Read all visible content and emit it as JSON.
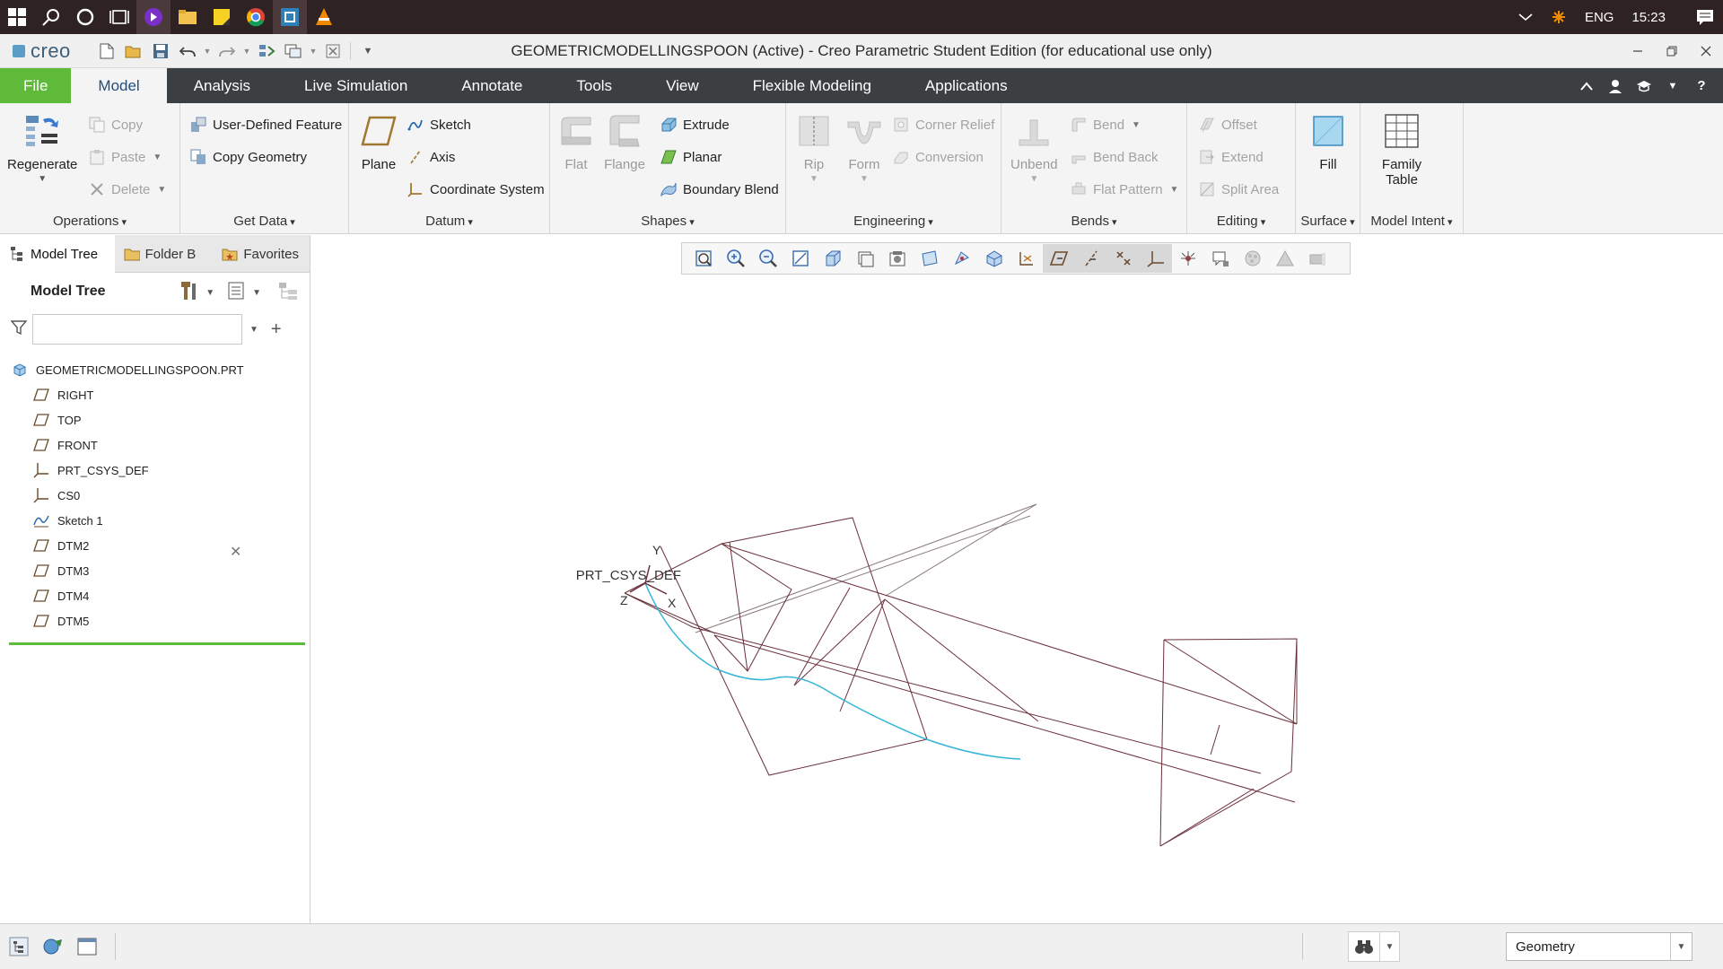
{
  "taskbar": {
    "tray": {
      "lang": "ENG",
      "time": "15:23"
    }
  },
  "window": {
    "app_logo": "creo",
    "title": "GEOMETRICMODELLINGSPOON (Active) - Creo Parametric Student Edition (for educational use only)"
  },
  "ribbon_tabs": [
    "File",
    "Model",
    "Analysis",
    "Live Simulation",
    "Annotate",
    "Tools",
    "View",
    "Flexible Modeling",
    "Applications"
  ],
  "ribbon": {
    "operations": {
      "label": "Operations",
      "regenerate": "Regenerate",
      "copy": "Copy",
      "paste": "Paste",
      "delete": "Delete"
    },
    "get_data": {
      "label": "Get Data",
      "udf": "User-Defined Feature",
      "copy_geometry": "Copy Geometry"
    },
    "datum": {
      "label": "Datum",
      "plane": "Plane",
      "sketch": "Sketch",
      "axis": "Axis",
      "csys": "Coordinate System"
    },
    "shapes": {
      "label": "Shapes",
      "flat": "Flat",
      "flange": "Flange",
      "extrude": "Extrude",
      "planar": "Planar",
      "boundary_blend": "Boundary Blend"
    },
    "engineering": {
      "label": "Engineering",
      "rip": "Rip",
      "form": "Form",
      "corner_relief": "Corner Relief",
      "conversion": "Conversion"
    },
    "bends": {
      "label": "Bends",
      "unbend": "Unbend",
      "bend": "Bend",
      "bend_back": "Bend Back",
      "flat_pattern": "Flat Pattern"
    },
    "editing": {
      "label": "Editing",
      "offset": "Offset",
      "extend": "Extend",
      "split_area": "Split Area"
    },
    "surface": {
      "label": "Surface",
      "fill": "Fill"
    },
    "model_intent": {
      "label": "Model Intent",
      "family_table_1": "Family",
      "family_table_2": "Table"
    }
  },
  "panel": {
    "tabs": [
      "Model Tree",
      "Folder B",
      "Favorites"
    ],
    "header": "Model Tree",
    "filter_placeholder": "",
    "root": "GEOMETRICMODELLINGSPOON.PRT",
    "items": [
      {
        "label": "RIGHT",
        "icon": "datum-plane-icon"
      },
      {
        "label": "TOP",
        "icon": "datum-plane-icon"
      },
      {
        "label": "FRONT",
        "icon": "datum-plane-icon"
      },
      {
        "label": "PRT_CSYS_DEF",
        "icon": "csys-icon"
      },
      {
        "label": "CS0",
        "icon": "csys-icon"
      },
      {
        "label": "Sketch 1",
        "icon": "sketch-icon"
      },
      {
        "label": "DTM2",
        "icon": "datum-plane-icon"
      },
      {
        "label": "DTM3",
        "icon": "datum-plane-icon"
      },
      {
        "label": "DTM4",
        "icon": "datum-plane-icon"
      },
      {
        "label": "DTM5",
        "icon": "datum-plane-icon"
      }
    ]
  },
  "viewport": {
    "csys_label": "PRT_CSYS_DEF",
    "axis_x": "X",
    "axis_y": "Y",
    "axis_z": "Z",
    "datum_color": "#6b2f3a",
    "curve_color": "#33b5d8"
  },
  "statusbar": {
    "selection_filter": "Geometry"
  },
  "colors": {
    "file_tab": "#5fba3a",
    "ribbon_tab_bar": "#3b3f42",
    "taskbar": "#2f2223"
  }
}
